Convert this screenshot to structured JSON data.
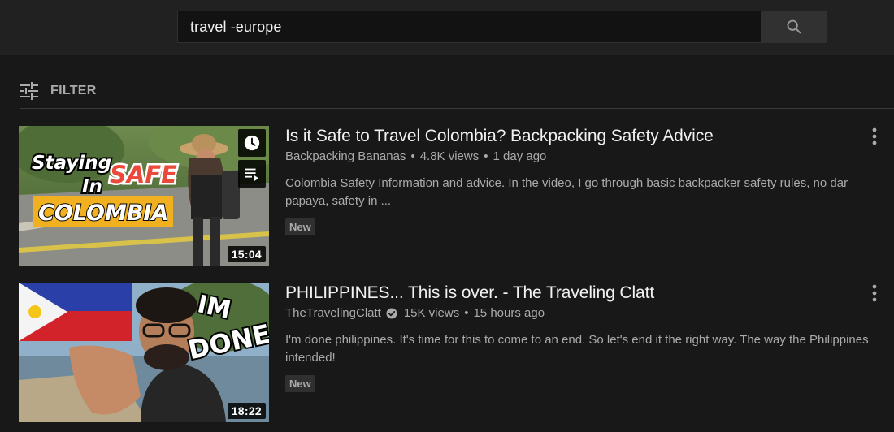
{
  "search": {
    "query": "travel -europe",
    "button_icon": "search-icon"
  },
  "filter": {
    "label": "FILTER",
    "icon": "filter-sliders-icon"
  },
  "colors": {
    "background": "#181818",
    "masthead": "#212121",
    "text_primary": "#f1f1f1",
    "text_secondary": "#aaaaaa"
  },
  "results": [
    {
      "title": "Is it Safe to Travel Colombia? Backpacking Safety Advice",
      "channel": "Backpacking Bananas",
      "views": "4.8K views",
      "age": "1 day ago",
      "description": "Colombia Safety Information and advice. In the video, I go through basic backpacker safety rules, no dar papaya, safety in ...",
      "badge": "New",
      "duration": "15:04",
      "verified": false,
      "thumb_text": [
        "Staying",
        "In",
        "SAFE",
        "COLOMBIA"
      ]
    },
    {
      "title": "PHILIPPINES... This is over. - The Traveling Clatt",
      "channel": "TheTravelingClatt",
      "views": "15K views",
      "age": "15 hours ago",
      "description": "I'm done philippines. It's time for this to come to an end. So let's end it the right way. The way the Philippines intended!",
      "badge": "New",
      "duration": "18:22",
      "verified": true,
      "thumb_text": [
        "IM",
        "DONE"
      ]
    }
  ],
  "separator": "•"
}
